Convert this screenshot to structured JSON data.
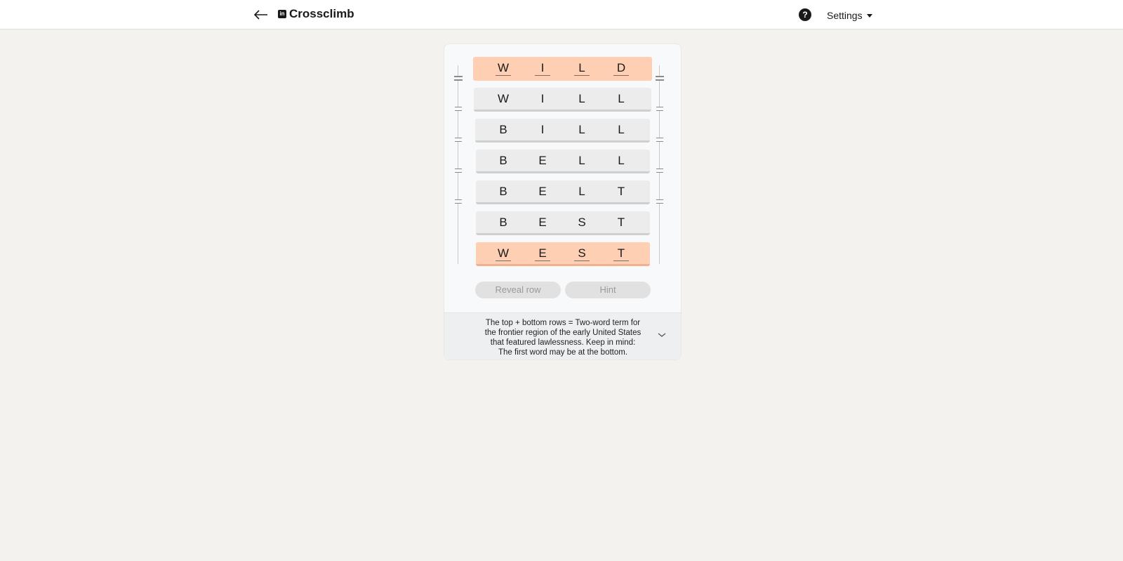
{
  "header": {
    "back_icon": "arrow-left-icon",
    "logo_icon": "linkedin-logo-icon",
    "logo_text": "in",
    "title": "Crossclimb",
    "help_icon": "question-circle-icon",
    "help_glyph": "?",
    "settings_label": "Settings"
  },
  "puzzle": {
    "rows": [
      {
        "letters": [
          "W",
          "I",
          "L",
          "D"
        ],
        "locked": true
      },
      {
        "letters": [
          "W",
          "I",
          "L",
          "L"
        ],
        "locked": false
      },
      {
        "letters": [
          "B",
          "I",
          "L",
          "L"
        ],
        "locked": false
      },
      {
        "letters": [
          "B",
          "E",
          "L",
          "L"
        ],
        "locked": false
      },
      {
        "letters": [
          "B",
          "E",
          "L",
          "T"
        ],
        "locked": false
      },
      {
        "letters": [
          "B",
          "E",
          "S",
          "T"
        ],
        "locked": false
      },
      {
        "letters": [
          "W",
          "E",
          "S",
          "T"
        ],
        "locked": true
      }
    ]
  },
  "buttons": {
    "reveal_row": "Reveal row",
    "hint": "Hint"
  },
  "clue": {
    "text": "The top + bottom rows = Two-word term for the frontier region of the early United States that featured lawlessness. Keep in mind: The first word may be at the bottom."
  },
  "colors": {
    "locked_row": "#ffcfb3",
    "row": "#ececec",
    "background": "#f3f2ef"
  }
}
